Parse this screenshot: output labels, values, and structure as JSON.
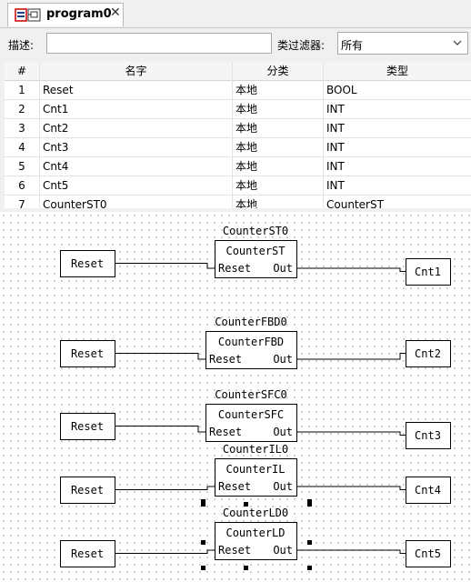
{
  "tab": {
    "title": "program0",
    "close": "✕",
    "icon": "pou-editor-icon"
  },
  "filter": {
    "description_label": "描述:",
    "description_value": "",
    "class_filter_label": "类过滤器:",
    "class_filter_value": "所有"
  },
  "variables": {
    "columns": [
      "#",
      "名字",
      "分类",
      "类型"
    ],
    "rows": [
      {
        "num": "1",
        "name": "Reset",
        "class": "本地",
        "type": "BOOL"
      },
      {
        "num": "2",
        "name": "Cnt1",
        "class": "本地",
        "type": "INT"
      },
      {
        "num": "3",
        "name": "Cnt2",
        "class": "本地",
        "type": "INT"
      },
      {
        "num": "4",
        "name": "Cnt3",
        "class": "本地",
        "type": "INT"
      },
      {
        "num": "5",
        "name": "Cnt4",
        "class": "本地",
        "type": "INT"
      },
      {
        "num": "6",
        "name": "Cnt5",
        "class": "本地",
        "type": "INT"
      },
      {
        "num": "7",
        "name": "CounterST0",
        "class": "本地",
        "type": "CounterST"
      }
    ]
  },
  "diagram": {
    "blocks": [
      {
        "instance": "CounterST0",
        "type": "CounterST",
        "input": "Reset",
        "output": "Out",
        "in_var": "Reset",
        "out_var": "Cnt1",
        "selected": false
      },
      {
        "instance": "CounterFBD0",
        "type": "CounterFBD",
        "input": "Reset",
        "output": "Out",
        "in_var": "Reset",
        "out_var": "Cnt2",
        "selected": false
      },
      {
        "instance": "CounterSFC0",
        "type": "CounterSFC",
        "input": "Reset",
        "output": "Out",
        "in_var": "Reset",
        "out_var": "Cnt3",
        "selected": false
      },
      {
        "instance": "CounterIL0",
        "type": "CounterIL",
        "input": "Reset",
        "output": "Out",
        "in_var": "Reset",
        "out_var": "Cnt4",
        "selected": true
      },
      {
        "instance": "CounterLD0",
        "type": "CounterLD",
        "input": "Reset",
        "output": "Out",
        "in_var": "Reset",
        "out_var": "Cnt5",
        "selected": true
      }
    ]
  },
  "colors": {
    "accent": "#cc0000",
    "grid_dot": "#c4c4c4",
    "line": "#000000"
  }
}
